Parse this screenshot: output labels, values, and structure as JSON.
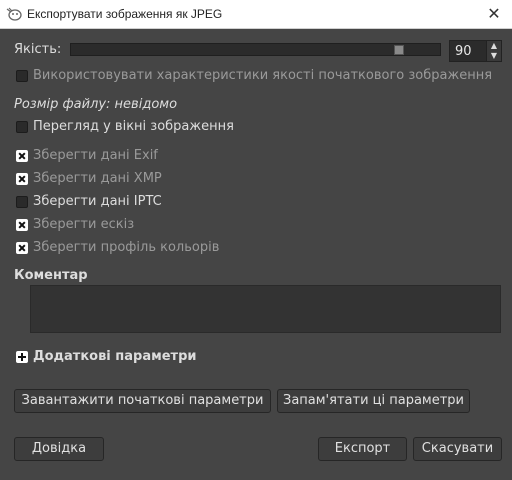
{
  "window": {
    "title": "Експортувати зображення як JPEG",
    "close_glyph": "✕"
  },
  "quality": {
    "label": "Якість:",
    "value": "90",
    "slider_level": 0.9,
    "spin_up": "▲",
    "spin_down": "▼"
  },
  "use_original_quality": {
    "label": "Використовувати характеристики якості початкового зображення",
    "checked": false,
    "enabled": false
  },
  "file_size": "Розмір файлу: невідомо",
  "preview": {
    "label": "Перегляд у вікні зображення",
    "checked": false
  },
  "save_options": [
    {
      "label": "Зберегти дані Exif",
      "checked": true,
      "enabled": false
    },
    {
      "label": "Зберегти дані XMP",
      "checked": true,
      "enabled": false
    },
    {
      "label": "Зберегти дані IPTC",
      "checked": false,
      "enabled": true
    },
    {
      "label": "Зберегти ескіз",
      "checked": true,
      "enabled": false
    },
    {
      "label": "Зберегти профіль кольорів",
      "checked": true,
      "enabled": false
    }
  ],
  "comment": {
    "label": "Коментар",
    "value": ""
  },
  "advanced": {
    "label": "Додаткові параметри"
  },
  "buttons": {
    "load_defaults": "Завантажити початкові параметри",
    "save_defaults": "Запам'ятати ці параметри",
    "help": "Довідка",
    "export": "Експорт",
    "cancel": "Скасувати"
  },
  "colors": {
    "background": "#454545",
    "titlebar": "#ffffff",
    "field": "#2b2b2b"
  }
}
